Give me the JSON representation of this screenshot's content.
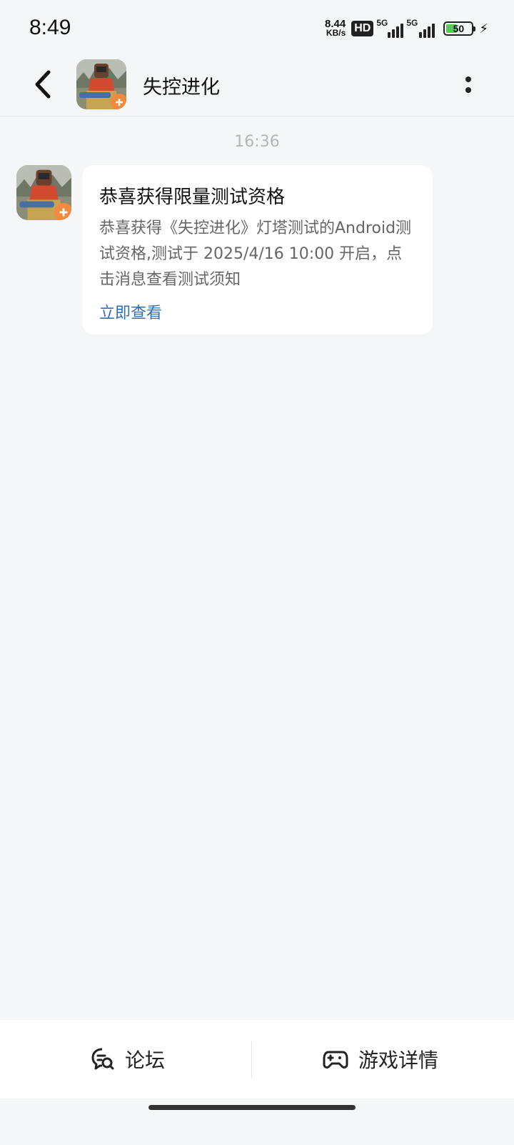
{
  "status_bar": {
    "time": "8:49",
    "speed_value": "8.44",
    "speed_unit": "KB/s",
    "hd_label": "HD",
    "sim1_label": "5G",
    "sim2_label": "5G",
    "battery_level": "50",
    "battery_color": "#5cc85a"
  },
  "header": {
    "title": "失控进化",
    "back_icon": "chevron-left-icon",
    "more_icon": "more-vertical-icon"
  },
  "chat": {
    "timestamp": "16:36",
    "message": {
      "title": "恭喜获得限量测试资格",
      "body": "恭喜获得《失控进化》灯塔测试的Android测试资格,测试于 2025/4/16 10:00 开启，点击消息查看测试须知",
      "link_label": "立即查看",
      "link_color": "#2f6fb5"
    }
  },
  "bottom_bar": {
    "forum_label": "论坛",
    "forum_icon": "forum-chat-search-icon",
    "detail_label": "游戏详情",
    "detail_icon": "gamepad-icon"
  }
}
